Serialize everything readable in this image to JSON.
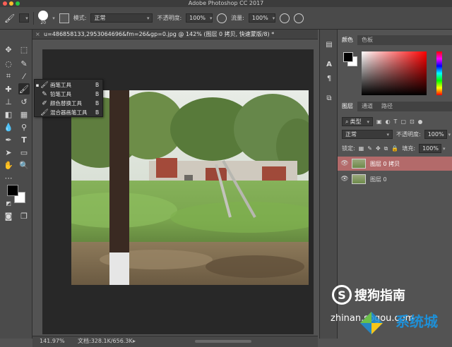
{
  "app": {
    "title": "Adobe Photoshop CC 2017"
  },
  "options": {
    "brush_size": "20",
    "mode_label": "模式:",
    "mode_value": "正常",
    "opacity_label": "不透明度:",
    "opacity_value": "100%",
    "flow_label": "流量:",
    "flow_value": "100%"
  },
  "document": {
    "tab_title": "u=486858133,2953064696&fm=26&gp=0.jpg @ 142% (图层 0 拷贝, 快速蒙版/8) *",
    "zoom": "141.97%",
    "doc_size": "文档:328.1K/656.3K"
  },
  "flyout": {
    "items": [
      {
        "label": "画笔工具",
        "key": "B",
        "selected": true
      },
      {
        "label": "铅笔工具",
        "key": "B",
        "selected": false
      },
      {
        "label": "颜色替换工具",
        "key": "B",
        "selected": false
      },
      {
        "label": "混合器画笔工具",
        "key": "B",
        "selected": false
      }
    ]
  },
  "color_panel": {
    "tabs": [
      "颜色",
      "色板"
    ]
  },
  "layers_panel": {
    "tabs": [
      "图层",
      "通道",
      "路径"
    ],
    "filter_label": "类型",
    "blend_mode": "正常",
    "opacity_label": "不透明度:",
    "opacity_value": "100%",
    "lock_label": "锁定:",
    "fill_label": "填充:",
    "fill_value": "100%",
    "layers": [
      {
        "name": "图层 0 拷贝",
        "selected": true
      },
      {
        "name": "图层 0",
        "selected": false
      }
    ]
  },
  "watermark": {
    "text1": "搜狗指南",
    "text2": "zhinan.sogou.com",
    "text3": "系统城"
  },
  "colors": {
    "accent_layer_selected": "#b36a6a",
    "panel_bg": "#535353",
    "canvas_bg": "#282828"
  }
}
